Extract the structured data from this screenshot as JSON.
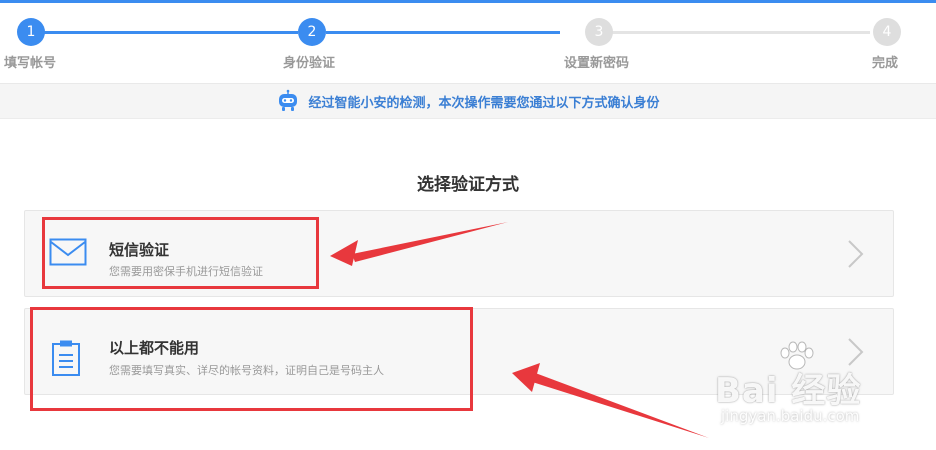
{
  "steps": [
    {
      "number": "1",
      "label": "填写帐号",
      "state": "completed"
    },
    {
      "number": "2",
      "label": "身份验证",
      "state": "current"
    },
    {
      "number": "3",
      "label": "设置新密码",
      "state": "pending"
    },
    {
      "number": "4",
      "label": "完成",
      "state": "pending"
    }
  ],
  "notice": {
    "text": "经过智能小安的检测，本次操作需要您通过以下方式确认身份",
    "icon": "robot-icon",
    "color": "#3b7fd4"
  },
  "section_title": "选择验证方式",
  "options": [
    {
      "title": "短信验证",
      "description": "您需要用密保手机进行短信验证",
      "icon": "envelope-icon"
    },
    {
      "title": "以上都不能用",
      "description": "您需要填写真实、详尽的帐号资料，证明自己是号码主人",
      "icon": "clipboard-icon"
    }
  ],
  "annotations": {
    "highlight_color": "#e8383d"
  },
  "watermark": {
    "brand": "Bai 经验",
    "url": "jingyan.baidu.com"
  },
  "colors": {
    "accent": "#3b8cf0",
    "inactive": "#dedede"
  }
}
